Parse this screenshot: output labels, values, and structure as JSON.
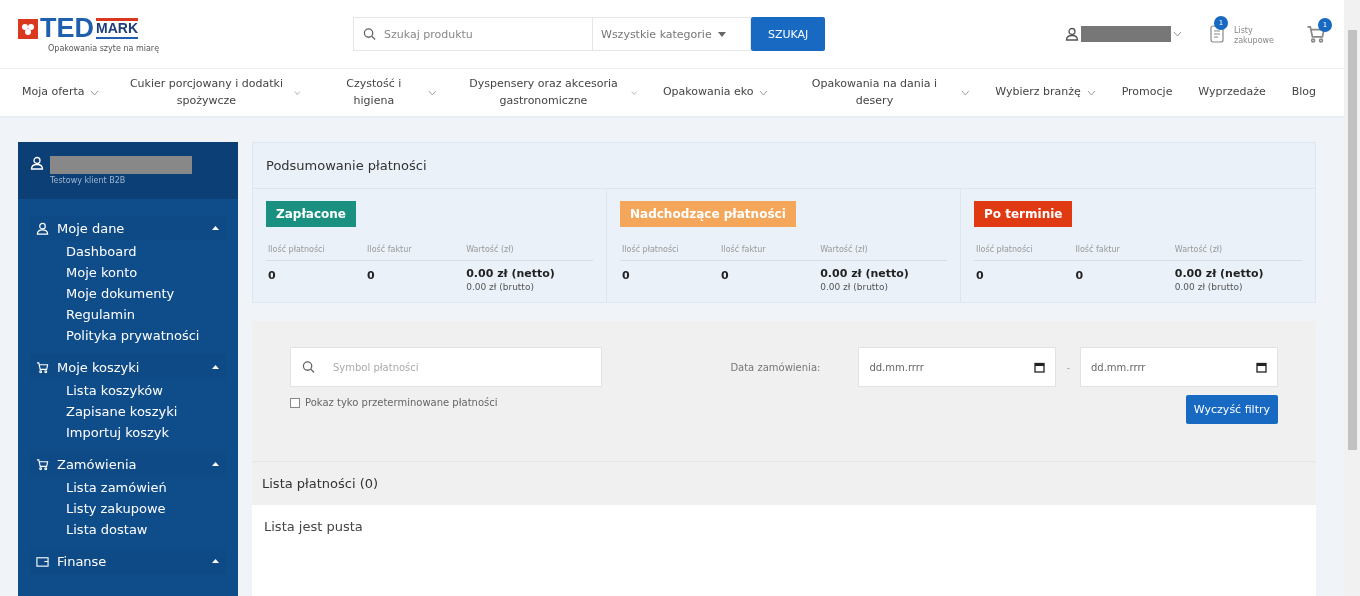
{
  "header": {
    "logo": {
      "brand": "TED",
      "brand_suffix": "MARK",
      "tagline": "Opakowania szyte na miarę"
    },
    "search": {
      "placeholder": "Szukaj produktu",
      "category": "Wszystkie kategorie",
      "button": "SZUKAJ"
    },
    "shopping_lists": {
      "label": "Listy zakupowe",
      "badge": "1"
    },
    "cart": {
      "badge": "1"
    }
  },
  "nav": [
    {
      "label": "Moja oferta",
      "dropdown": true
    },
    {
      "label": "Cukier porcjowany i dodatki spożywcze",
      "dropdown": true
    },
    {
      "label": "Czystość i higiena",
      "dropdown": true
    },
    {
      "label": "Dyspensery oraz akcesoria gastronomiczne",
      "dropdown": true
    },
    {
      "label": "Opakowania eko",
      "dropdown": true
    },
    {
      "label": "Opakowania na dania i desery",
      "dropdown": true
    },
    {
      "label": "Wybierz branżę",
      "dropdown": true
    },
    {
      "label": "Promocje",
      "dropdown": false
    },
    {
      "label": "Wyprzedaże",
      "dropdown": false
    },
    {
      "label": "Blog",
      "dropdown": false
    }
  ],
  "sidebar": {
    "user_caption": "Testowy klient B2B",
    "sections": [
      {
        "title": "Moje dane",
        "kind": "user",
        "expanded": true,
        "items": [
          "Dashboard",
          "Moje konto",
          "Moje dokumenty",
          "Regulamin",
          "Polityka prywatności"
        ]
      },
      {
        "title": "Moje koszyki",
        "kind": "cart",
        "expanded": true,
        "items": [
          "Lista koszyków",
          "Zapisane koszyki",
          "Importuj koszyk"
        ]
      },
      {
        "title": "Zamówienia",
        "kind": "cart",
        "expanded": true,
        "items": [
          "Lista zamówień",
          "Listy zakupowe",
          "Lista dostaw"
        ]
      },
      {
        "title": "Finanse",
        "kind": "wallet",
        "expanded": true
      }
    ]
  },
  "summary": {
    "title": "Podsumowanie płatności",
    "groups": [
      {
        "label": "Zapłacone",
        "color": "#1a9180",
        "columns": [
          "Ilość płatności",
          "Ilość faktur",
          "Wartość (zł)"
        ],
        "count": "0",
        "invoices": "0",
        "net": "0.00 zł (netto)",
        "gross": "0.00 zł (brutto)"
      },
      {
        "label": "Nadchodzące płatności",
        "color": "#f4a65a",
        "columns": [
          "Ilość płatności",
          "Ilość faktur",
          "Wartość (zł)"
        ],
        "count": "0",
        "invoices": "0",
        "net": "0.00 zł (netto)",
        "gross": "0.00 zł (brutto)"
      },
      {
        "label": "Po terminie",
        "color": "#e03a12",
        "columns": [
          "Ilość płatności",
          "Ilość faktur",
          "Wartość (zł)"
        ],
        "count": "0",
        "invoices": "0",
        "net": "0.00 zł (netto)",
        "gross": "0.00 zł (brutto)"
      }
    ]
  },
  "filters": {
    "search_placeholder": "Symbol płatności",
    "overdue_only": {
      "label": "Pokaz tyko przeterminowane płatności",
      "checked": false
    },
    "date_label": "Data zamówienia:",
    "date_from": "dd.mm.rrrr",
    "date_to": "dd.mm.rrrr",
    "separator": "-",
    "clear_button": "Wyczyść filtry"
  },
  "list": {
    "title": "Lista płatności (0)",
    "empty_text": "Lista jest pusta"
  }
}
